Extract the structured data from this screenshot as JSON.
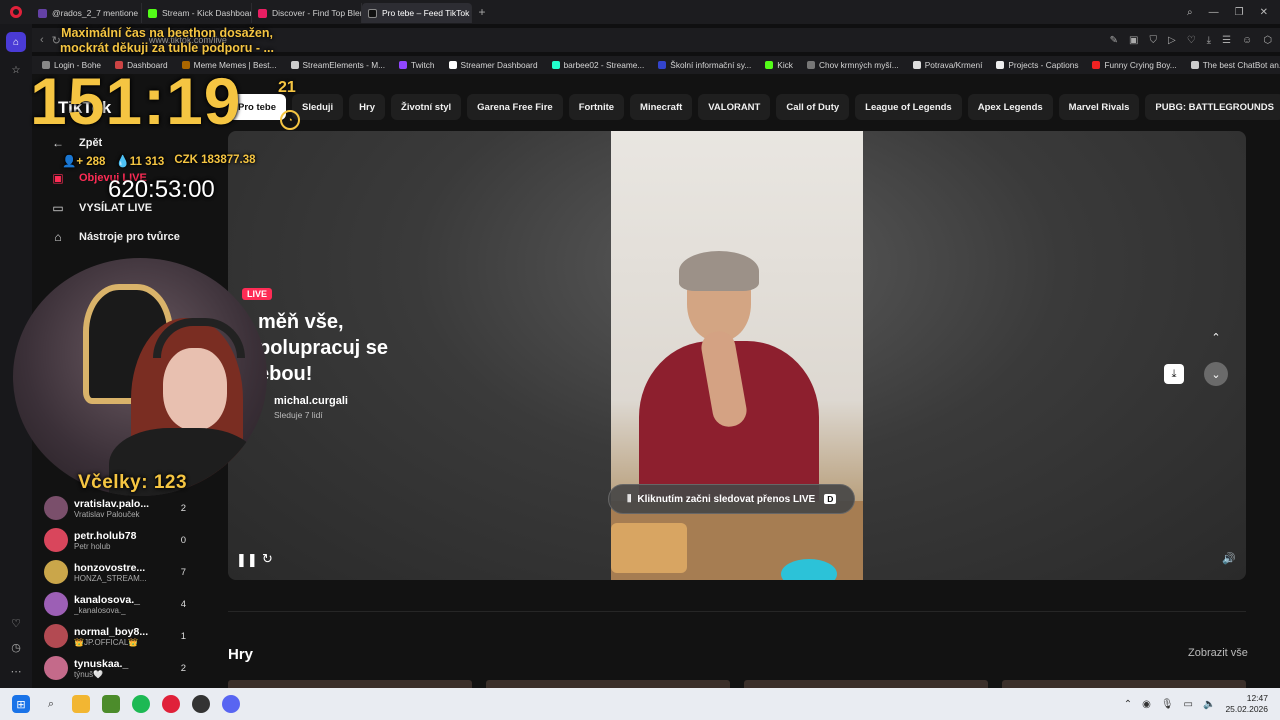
{
  "browser": {
    "tabs": [
      {
        "label": "@rados_2_7 mentione",
        "color": "#6441a5"
      },
      {
        "label": "Stream - Kick Dashboard",
        "color": "#53fc18"
      },
      {
        "label": "Discover - Find Top Blerp",
        "color": "#e91e63"
      },
      {
        "label": "Pro tebe – Feed TikTok",
        "color": "#111111",
        "active": true
      }
    ],
    "url": "www.tiktok.com/live",
    "bookmarks": [
      "Login - Bohe",
      "Dashboard",
      "Meme Memes | Best...",
      "StreamElements - M...",
      "Twitch",
      "Streamer Dashboard",
      "barbee02 - Streame...",
      "Školní informační sy...",
      "Kick",
      "Chov krmných myší...",
      "Potrava/Krmení",
      "Projects - Captions",
      "Funny Crying Boy...",
      "The best ChatBot an..."
    ]
  },
  "tiktok": {
    "logo": "TikTok",
    "nav": {
      "back": "Zpět",
      "explore_live": "Objevuj LIVE",
      "go_live": "VYSÍLAT LIVE",
      "creator_tools": "Nástroje pro tvůrce"
    },
    "categories": [
      "Pro tebe",
      "Sleduji",
      "Hry",
      "Životní styl",
      "Garena Free Fire",
      "Fortnite",
      "Minecraft",
      "VALORANT",
      "Call of Duty",
      "League of Legends",
      "Apex Legends",
      "Marvel Rivals",
      "PUBG: BATTLEGROUNDS"
    ],
    "live": {
      "badge": "LIVE",
      "title": "měň vše, polupracuj se ebou!",
      "host": "michal.curgali",
      "follow_info": "Sleduje 7 lidí",
      "cta": "Kliknutím začni sledovat přenos LIVE",
      "cta_key": "D"
    },
    "section": {
      "title": "Hry",
      "more": "Zobrazit vše"
    },
    "viewers": [
      {
        "user": "vratislav.palo...",
        "display": "Vratislav Palouček",
        "count": "2",
        "color": "#7a4f6b"
      },
      {
        "user": "petr.holub78",
        "display": "Petr holub",
        "count": "0",
        "color": "#d9465c"
      },
      {
        "user": "honzovostre...",
        "display": "HONZA_STREAM...",
        "count": "7",
        "color": "#caa64a"
      },
      {
        "user": "kanalosova._",
        "display": "_kanalosova._",
        "count": "4",
        "color": "#9c5fb5"
      },
      {
        "user": "normal_boy8...",
        "display": "👑JP.OFFICAL👑",
        "count": "1",
        "color": "#b34a52"
      },
      {
        "user": "tynuskaa._",
        "display": "týnuš🤍",
        "count": "2",
        "color": "#c46a8a"
      }
    ]
  },
  "overlay": {
    "goal_text": "Maximální čas na beethon dosažen, mockrát děkuji za tuhle podporu - ...",
    "timer": "151:19",
    "timer_small": "21",
    "followers": "+ 288",
    "likes": "11 313",
    "money": "CZK 183877.38",
    "second_timer": "620:53:00",
    "bees_label": "Včelky:",
    "bees_count": "123"
  },
  "taskbar": {
    "time": "12:47",
    "date": "25.02.2026"
  }
}
